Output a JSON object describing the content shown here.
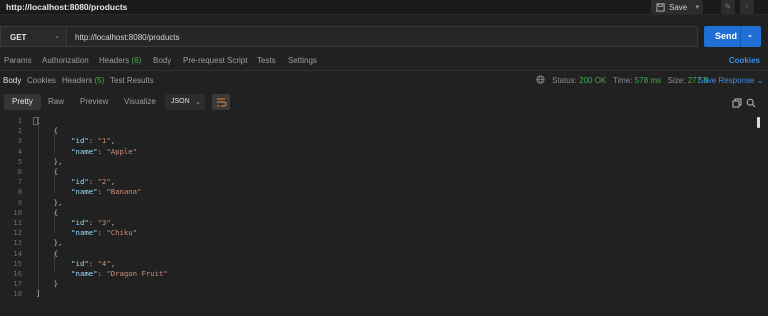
{
  "window": {
    "title": "http://localhost:8080/products",
    "save_label": "Save"
  },
  "request": {
    "method": "GET",
    "url": "http://localhost:8080/products",
    "send_label": "Send"
  },
  "request_tabs": [
    {
      "label": "Params"
    },
    {
      "label": "Authorization"
    },
    {
      "label": "Headers",
      "count": "(6)"
    },
    {
      "label": "Body"
    },
    {
      "label": "Pre-request Script"
    },
    {
      "label": "Tests"
    },
    {
      "label": "Settings"
    }
  ],
  "cookies_link": "Cookies",
  "response_tabs": [
    {
      "label": "Body"
    },
    {
      "label": "Cookies"
    },
    {
      "label": "Headers",
      "count": "(5)"
    },
    {
      "label": "Test Results"
    }
  ],
  "status": {
    "status_label": "Status:",
    "status_value": "200 OK",
    "time_label": "Time:",
    "time_value": "578 ms",
    "size_label": "Size:",
    "size_value": "277 B",
    "save_response": "Save Response"
  },
  "view_modes": [
    "Pretty",
    "Raw",
    "Preview",
    "Visualize"
  ],
  "format": "JSON",
  "body_lines": [
    {
      "n": "1",
      "text": "["
    },
    {
      "n": "2",
      "text": "    {"
    },
    {
      "n": "3",
      "key": "\"id\"",
      "val": "\"1\"",
      "indent": "        ",
      "comma": ","
    },
    {
      "n": "4",
      "key": "\"name\"",
      "val": "\"Apple\"",
      "indent": "        ",
      "comma": ""
    },
    {
      "n": "5",
      "text": "    },"
    },
    {
      "n": "6",
      "text": "    {"
    },
    {
      "n": "7",
      "key": "\"id\"",
      "val": "\"2\"",
      "indent": "        ",
      "comma": ","
    },
    {
      "n": "8",
      "key": "\"name\"",
      "val": "\"Banana\"",
      "indent": "        ",
      "comma": ""
    },
    {
      "n": "9",
      "text": "    },"
    },
    {
      "n": "10",
      "text": "    {"
    },
    {
      "n": "11",
      "key": "\"id\"",
      "val": "\"3\"",
      "indent": "        ",
      "comma": ","
    },
    {
      "n": "12",
      "key": "\"name\"",
      "val": "\"Chiku\"",
      "indent": "        ",
      "comma": ""
    },
    {
      "n": "13",
      "text": "    },"
    },
    {
      "n": "14",
      "text": "    {"
    },
    {
      "n": "15",
      "key": "\"id\"",
      "val": "\"4\"",
      "indent": "        ",
      "comma": ","
    },
    {
      "n": "16",
      "key": "\"name\"",
      "val": "\"Dragon Fruit\"",
      "indent": "        ",
      "comma": ""
    },
    {
      "n": "17",
      "text": "    }"
    },
    {
      "n": "18",
      "text": "]"
    }
  ],
  "colors": {
    "accent": "#1f6fd6",
    "link": "#3b8ee8",
    "ok": "#3fae4f",
    "json_key": "#9cdcfe",
    "json_string": "#ce9178"
  }
}
